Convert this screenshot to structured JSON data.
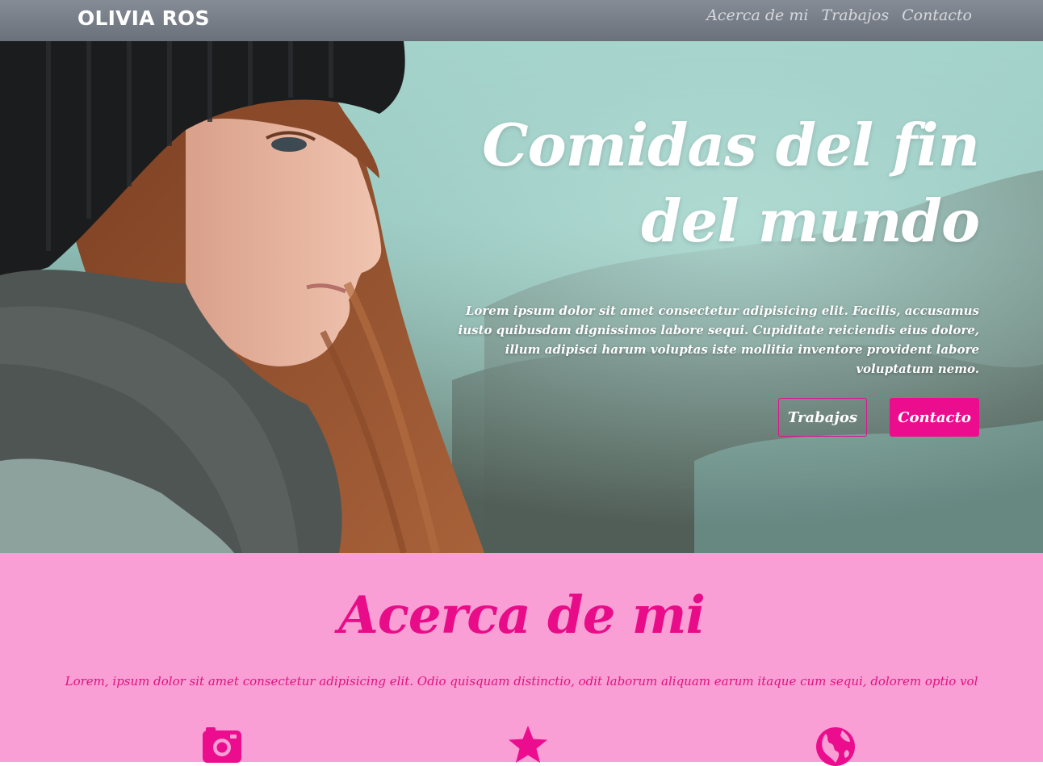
{
  "navbar": {
    "brand": "OLIVIA ROS",
    "links": [
      "Acerca de mi",
      "Trabajos",
      "Contacto"
    ]
  },
  "hero": {
    "title_line1": "Comidas del fin",
    "title_line2": "del mundo",
    "body": "Lorem ipsum dolor sit amet consectetur adipisicing elit. Facilis, accusamus iusto quibusdam dignissimos labore sequi. Cupiditate reiciendis eius dolore, illum adipisci harum voluptas iste mollitia inventore provident labore voluptatum nemo.",
    "btn_outline": "Trabajos",
    "btn_solid": "Contacto"
  },
  "about": {
    "title": "Acerca de mi",
    "text": "Lorem, ipsum dolor sit amet consectetur adipisicing elit. Odio quisquam distinctio, odit laborum aliquam earum itaque cum sequi, dolorem optio vol",
    "icons": [
      "camera-icon",
      "star-icon",
      "globe-icon"
    ]
  },
  "colors": {
    "accent": "#ec0d8f",
    "about_bg": "#f99fd5",
    "nav_bg": "#757b84"
  }
}
